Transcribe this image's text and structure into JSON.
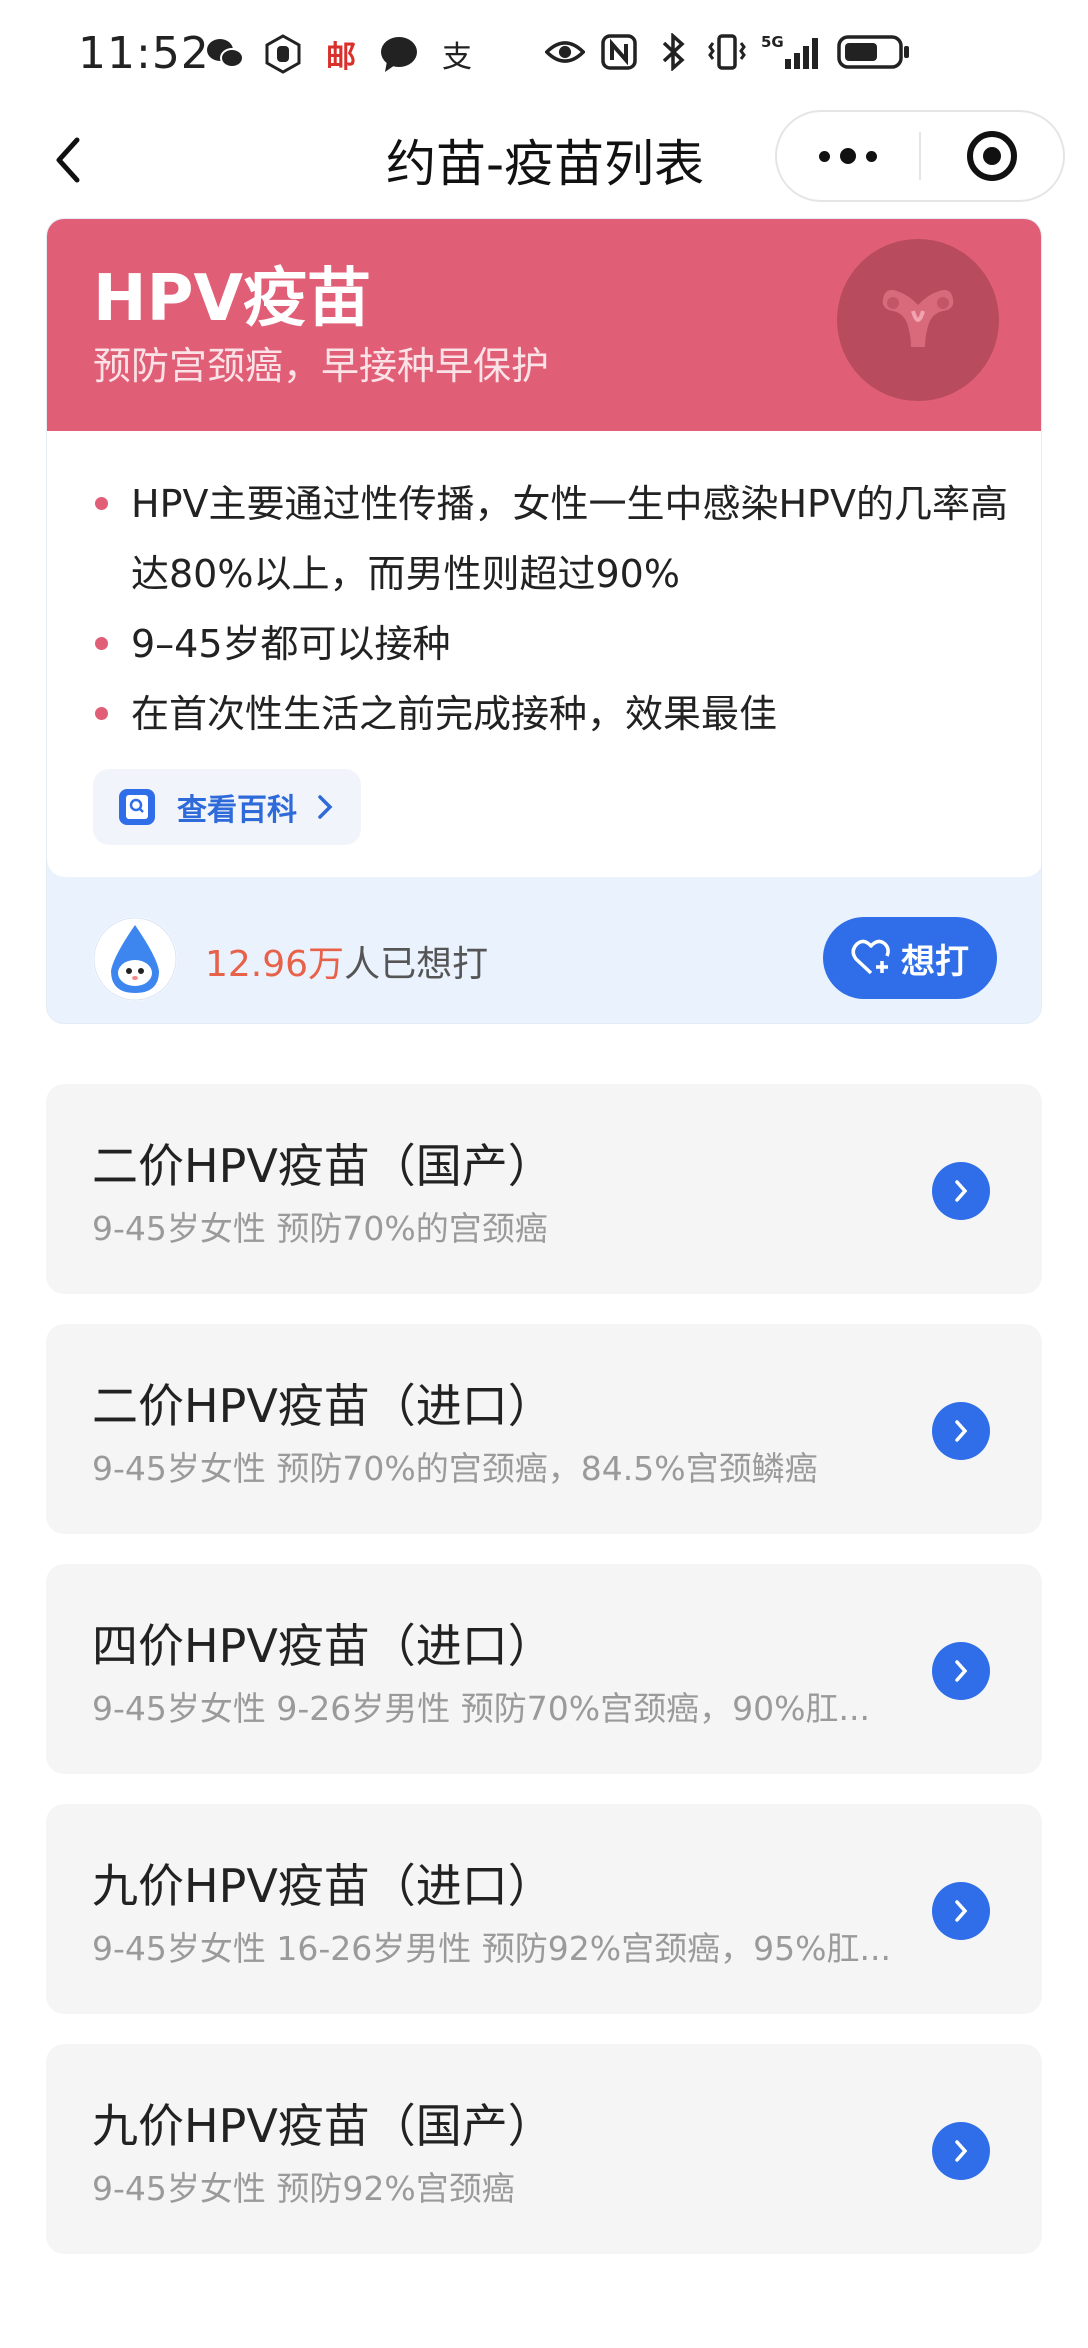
{
  "status_bar": {
    "time": "11:52",
    "left_icons": [
      "wechat-icon",
      "hand-icon",
      "mail-icon",
      "chat-icon",
      "alipay-icon"
    ],
    "right_icons": [
      "eye-icon",
      "nfc-icon",
      "bluetooth-icon",
      "vibrate-icon",
      "signal-5g-icon",
      "battery-icon"
    ],
    "mail_glyph": "邮",
    "alipay_glyph": "支",
    "network_label": "5G"
  },
  "nav": {
    "title": "约苗-疫苗列表"
  },
  "hero": {
    "title": "HPV疫苗",
    "subtitle": "预防宫颈癌，早接种早保护",
    "accent_color": "#e05f77",
    "bullets": [
      "HPV主要通过性传播，女性一生中感染HPV的几率高达80%以上，而男性则超过90%",
      "9–45岁都可以接种",
      "在首次性生活之前完成接种，效果最佳"
    ],
    "wiki_label": "查看百科",
    "want_count_number": "12.96万",
    "want_count_suffix": "人已想打",
    "want_button_label": "想打"
  },
  "vaccines": [
    {
      "name": "二价HPV疫苗（国产）",
      "desc": "9-45岁女性 预防70%的宫颈癌"
    },
    {
      "name": "二价HPV疫苗（进口）",
      "desc": "9-45岁女性 预防70%的宫颈癌，84.5%宫颈鳞癌"
    },
    {
      "name": "四价HPV疫苗（进口）",
      "desc": "9-45岁女性 9-26岁男性 预防70%宫颈癌，90%肛..."
    },
    {
      "name": "九价HPV疫苗（进口）",
      "desc": "9-45岁女性 16-26岁男性 预防92%宫颈癌，95%肛..."
    },
    {
      "name": "九价HPV疫苗（国产）",
      "desc": "9-45岁女性 预防92%宫颈癌"
    }
  ],
  "colors": {
    "primary_blue": "#2f6ee8",
    "count_red": "#e8624a"
  }
}
